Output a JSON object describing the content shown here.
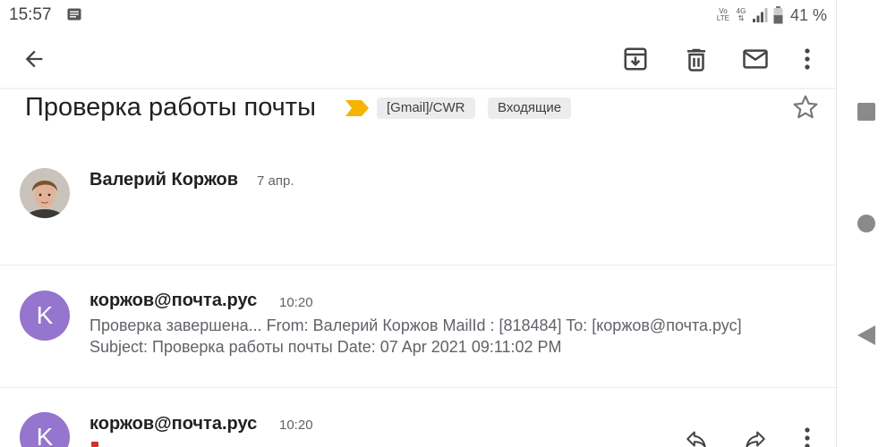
{
  "status_bar": {
    "time": "15:57",
    "volte_line1": "Vo",
    "volte_line2": "LTE",
    "network_line1": "4G",
    "network_line2": "⇅",
    "battery_percent": "41 %"
  },
  "toolbar": {
    "back_icon": "arrow-left",
    "archive_icon": "archive",
    "delete_icon": "trash",
    "mark_unread_icon": "envelope",
    "more_icon": "vertical-dots"
  },
  "thread": {
    "subject": "Проверка работы почты",
    "labels": [
      "[Gmail]/CWR",
      "Входящие"
    ],
    "starred": false,
    "importance_color": "#f4b400"
  },
  "messages": [
    {
      "sender": "Валерий Коржов",
      "date": "7 апр.",
      "avatar": "photo",
      "snippet_lines": []
    },
    {
      "sender": "коржов@почта.рус",
      "date": "10:20",
      "avatar": "K",
      "avatar_color": "#9575cd",
      "snippet_lines": [
        "Проверка завершена... From: Валерий Коржов MailId : [818484] To: [коржов@почта.рус]",
        "Subject: Проверка работы почты Date: 07 Apr 2021 09:11:02 PM"
      ]
    },
    {
      "sender": "коржов@почта.рус",
      "date": "10:20",
      "avatar": "K",
      "avatar_color": "#9575cd",
      "actions": [
        "reply-icon",
        "forward-icon",
        "more-icon"
      ]
    }
  ],
  "nav": [
    "square-recents",
    "circle-home",
    "triangle-back"
  ]
}
